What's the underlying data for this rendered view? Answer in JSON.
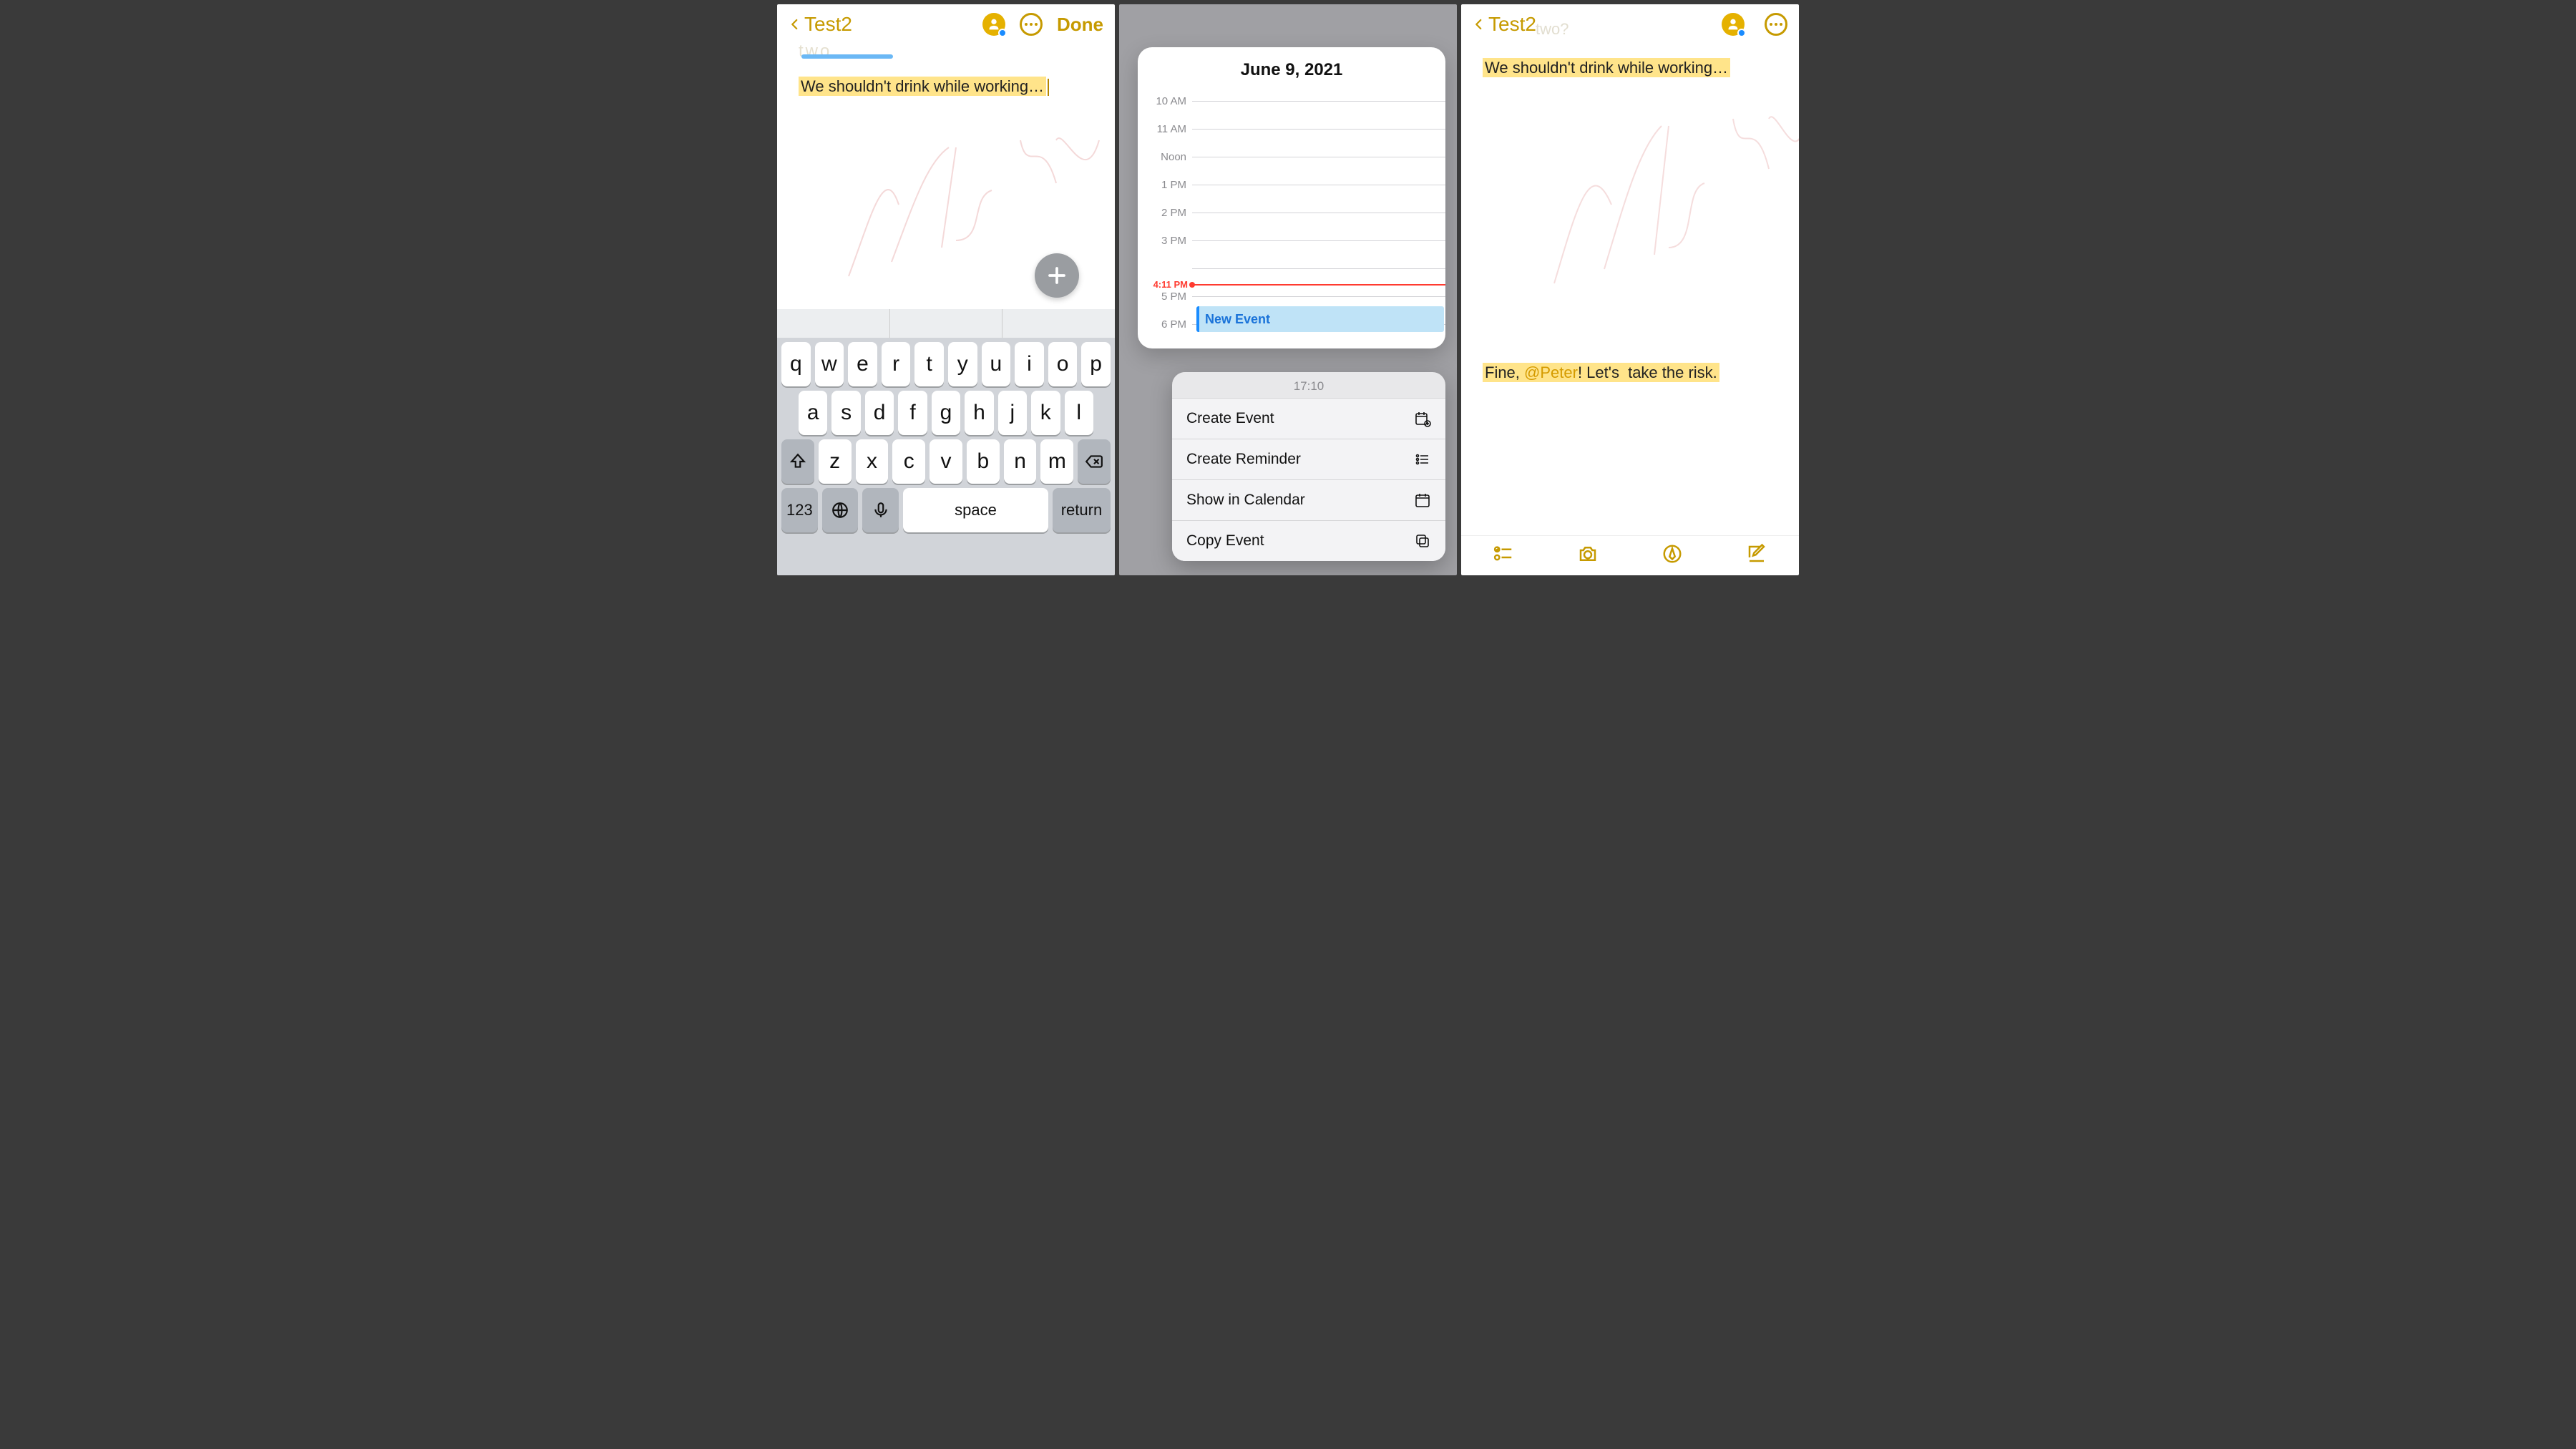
{
  "panel1": {
    "back_label": "Test2",
    "done_label": "Done",
    "ghost_text": "two",
    "note_text": "We shouldn't drink while working…",
    "keyboard": {
      "row1": [
        "q",
        "w",
        "e",
        "r",
        "t",
        "y",
        "u",
        "i",
        "o",
        "p"
      ],
      "row2": [
        "a",
        "s",
        "d",
        "f",
        "g",
        "h",
        "j",
        "k",
        "l"
      ],
      "row3": [
        "z",
        "x",
        "c",
        "v",
        "b",
        "n",
        "m"
      ],
      "num_key": "123",
      "space_label": "space",
      "return_label": "return"
    }
  },
  "panel2": {
    "calendar_title": "June 9, 2021",
    "time_slots": [
      "10 AM",
      "11 AM",
      "Noon",
      "1 PM",
      "2 PM",
      "3 PM",
      "",
      "5 PM",
      "6 PM"
    ],
    "now_label": "4:11 PM",
    "event_label": "New Event",
    "menu_time": "17:10",
    "menu_items": {
      "create_event": "Create Event",
      "create_reminder": "Create Reminder",
      "show_calendar": "Show in Calendar",
      "copy_event": "Copy Event"
    }
  },
  "panel3": {
    "back_label": "Test2",
    "ghost_text": "two?",
    "line1": "We shouldn't drink while working…",
    "line2_pre": "Fine, ",
    "line2_mention": "@Peter",
    "line2_mid": "! Let's ",
    "line2_hl": "take the risk."
  }
}
